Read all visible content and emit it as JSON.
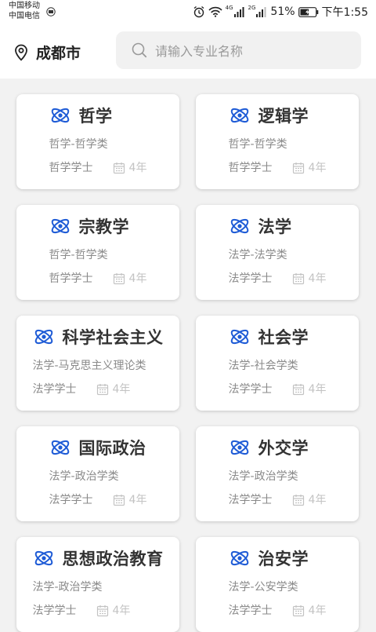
{
  "status_bar": {
    "carrier_1": "中国移动",
    "carrier_2": "中国电信",
    "net_1": "4G",
    "net_2": "2G",
    "battery": "51%",
    "time": "下午1:55"
  },
  "header": {
    "city": "成都市",
    "search_placeholder": "请输入专业名称"
  },
  "theme": {
    "accent": "#1e5bd6",
    "text_dark": "#333333",
    "text_muted": "#8a8a8a",
    "text_faint": "#c3c3c3"
  },
  "majors": [
    {
      "title": "哲学",
      "category": "哲学-哲学类",
      "degree": "哲学学士",
      "years": "4年"
    },
    {
      "title": "逻辑学",
      "category": "哲学-哲学类",
      "degree": "哲学学士",
      "years": "4年"
    },
    {
      "title": "宗教学",
      "category": "哲学-哲学类",
      "degree": "哲学学士",
      "years": "4年"
    },
    {
      "title": "法学",
      "category": "法学-法学类",
      "degree": "法学学士",
      "years": "4年"
    },
    {
      "title": "科学社会主义",
      "category": "法学-马克思主义理论类",
      "degree": "法学学士",
      "years": "4年"
    },
    {
      "title": "社会学",
      "category": "法学-社会学类",
      "degree": "法学学士",
      "years": "4年"
    },
    {
      "title": "国际政治",
      "category": "法学-政治学类",
      "degree": "法学学士",
      "years": "4年"
    },
    {
      "title": "外交学",
      "category": "法学-政治学类",
      "degree": "法学学士",
      "years": "4年"
    },
    {
      "title": "思想政治教育",
      "category": "法学-政治学类",
      "degree": "法学学士",
      "years": "4年"
    },
    {
      "title": "治安学",
      "category": "法学-公安学类",
      "degree": "法学学士",
      "years": "4年"
    }
  ]
}
